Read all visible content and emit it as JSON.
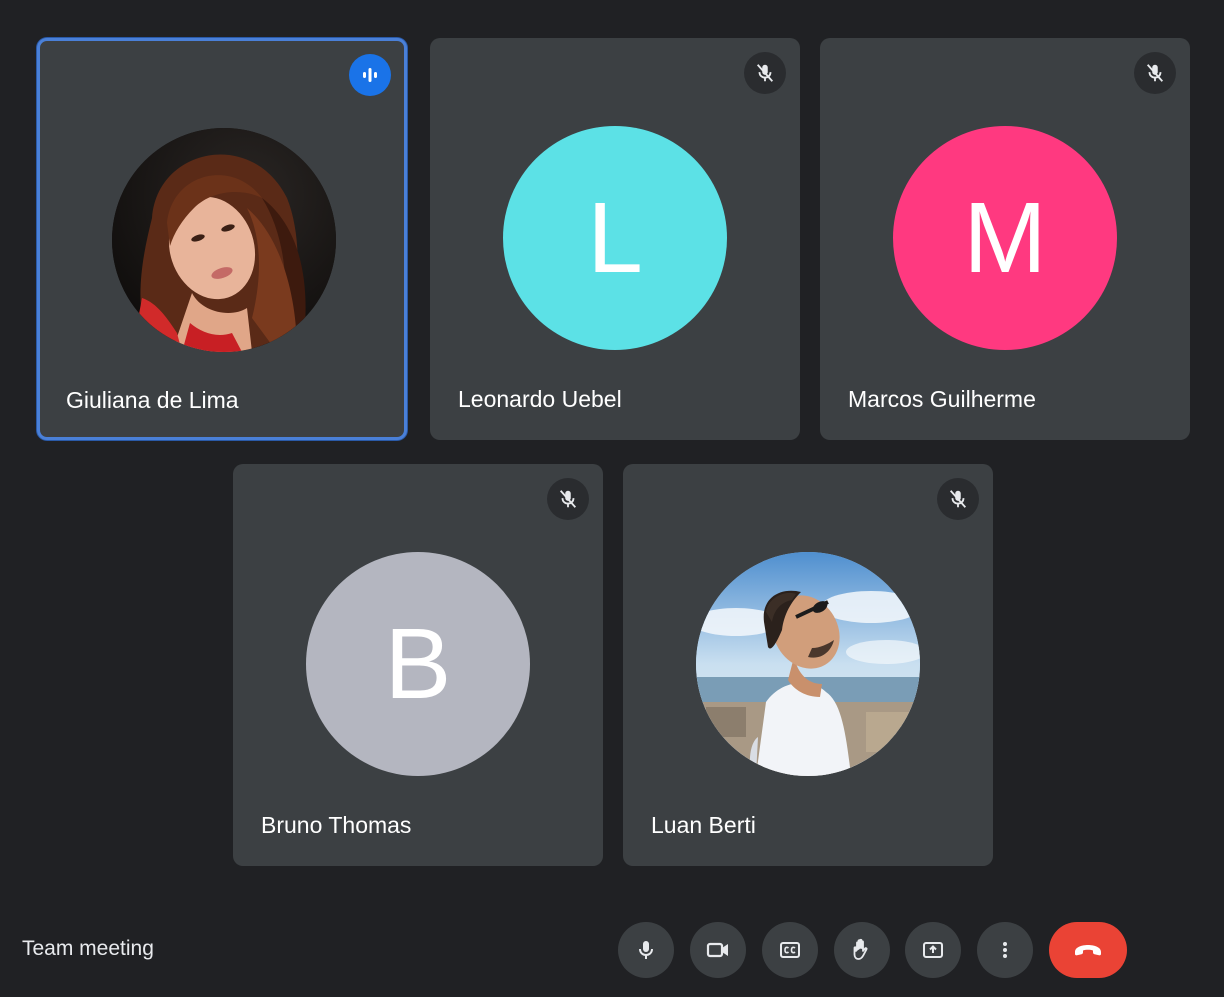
{
  "meeting": {
    "title": "Team meeting"
  },
  "participants": [
    {
      "name": "Giuliana de Lima",
      "initial": "",
      "avatar_color": "#5a2a1e",
      "speaking": true,
      "muted": false
    },
    {
      "name": "Leonardo Uebel",
      "initial": "L",
      "avatar_color": "#5ce1e6",
      "speaking": false,
      "muted": true
    },
    {
      "name": "Marcos Guilherme",
      "initial": "M",
      "avatar_color": "#ff3980",
      "speaking": false,
      "muted": true
    },
    {
      "name": "Bruno Thomas",
      "initial": "B",
      "avatar_color": "#b4b6c0",
      "speaking": false,
      "muted": true
    },
    {
      "name": "Luan Berti",
      "initial": "",
      "avatar_color": "#8fb7d8",
      "speaking": false,
      "muted": true
    }
  ],
  "controls": [
    {
      "icon": "microphone-icon"
    },
    {
      "icon": "camera-icon"
    },
    {
      "icon": "captions-icon"
    },
    {
      "icon": "raise-hand-icon"
    },
    {
      "icon": "present-screen-icon"
    },
    {
      "icon": "more-options-icon"
    },
    {
      "icon": "end-call-icon"
    }
  ],
  "colors": {
    "background": "#202124",
    "tile": "#3c4043",
    "speaking_border": "#4a80d8",
    "speaking_badge": "#1a73e8",
    "end_call": "#ea4335"
  }
}
